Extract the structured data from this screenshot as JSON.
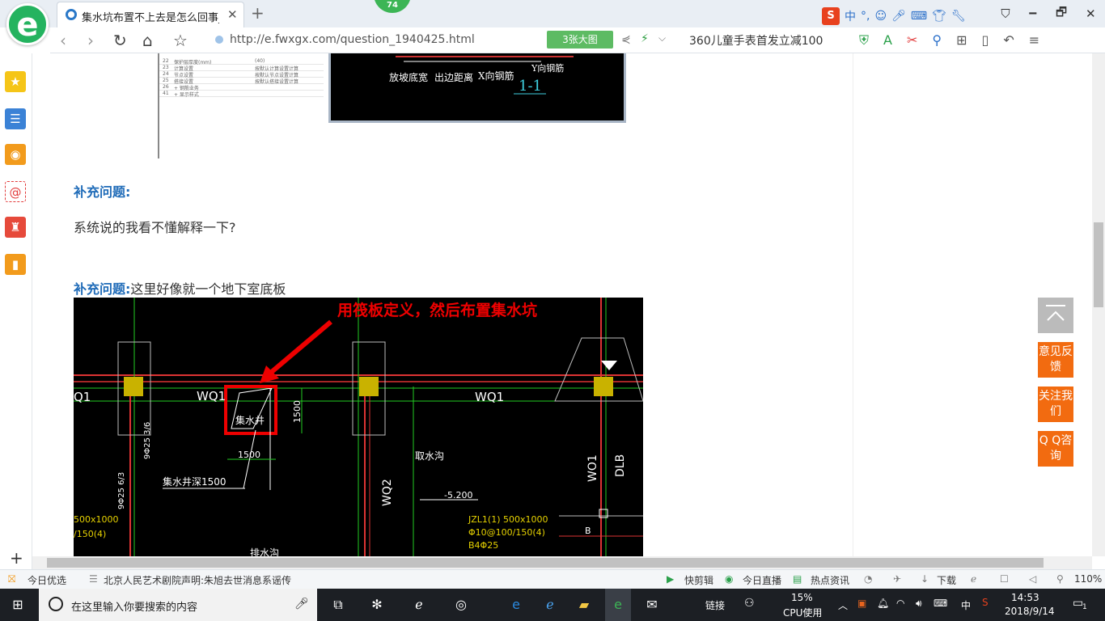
{
  "browser": {
    "tab_title": "集水坑布置不上去是怎么回事_广",
    "tab_close": "✕",
    "new_tab": "+",
    "badge": "74",
    "url": "http://e.fwxgx.com/question_1940425.html",
    "big_image_btn": "3张大图",
    "promo_text": "360儿童手表首发立减100",
    "ime_lang": "中",
    "ime_punct": "°,",
    "window_controls": [
      "🗕",
      "🗗",
      "✕"
    ]
  },
  "sidebar": {
    "items": [
      "favorites",
      "news",
      "weibo",
      "email",
      "game",
      "reader"
    ],
    "add": "+"
  },
  "page": {
    "table_rows": [
      {
        "no": "22",
        "name": "保护层厚度(mm)",
        "value": "(40)"
      },
      {
        "no": "23",
        "name": "计算设置",
        "value": "按默认计算设置计算"
      },
      {
        "no": "24",
        "name": "节点设置",
        "value": "按默认节点设置计算"
      },
      {
        "no": "25",
        "name": "搭接设置",
        "value": "按默认搭接设置计算"
      },
      {
        "no": "26",
        "name": "+ 钢筋业务",
        "value": ""
      },
      {
        "no": "41",
        "name": "+ 显示样式",
        "value": ""
      }
    ],
    "cad1_labels": {
      "y_rebar": "Y向钢筋",
      "slope": "放坡底宽",
      "edge": "出边距离",
      "x_rebar": "X向钢筋",
      "section": "1-1"
    },
    "q1_label": "补充问题:",
    "q1_text": "系统说的我看不懂解释一下?",
    "q2_label": "补充问题:",
    "q2_text": "这里好像就一个地下室底板",
    "cad2": {
      "annotation": "用筏板定义，然后布置集水坑",
      "wq1_a": "WQ1",
      "wq1_b": "WQ1",
      "q1": "Q1",
      "sump": "集水井",
      "dim_v": "1500",
      "dim_h": "1500",
      "sump_depth": "集水井深1500",
      "drain": "取水沟",
      "wq2": "WQ2",
      "wo1": "WO1",
      "dlb": "DLB",
      "elev": "-5.200",
      "beam": "JZL1(1) 500x1000",
      "stirrup": "Φ10@100/150(4)",
      "bars": "B4Φ25",
      "left_note1": "500x1000",
      "left_note2": "/150(4)",
      "rebar_v": "9Φ25 3/6",
      "rebar_v2": "9Φ25 6/3",
      "b_mark": "B",
      "drain2": "排水沟"
    }
  },
  "float_buttons": {
    "feedback": "意见反馈",
    "follow": "关注我们",
    "qq": "Q Q咨询"
  },
  "statusbar": {
    "today_pick": "今日优选",
    "headline": "北京人民艺术剧院声明:朱旭去世消息系谣传",
    "quick_cut": "快剪辑",
    "live": "今日直播",
    "hot_news": "热点资讯",
    "download": "下载",
    "zoom": "110%"
  },
  "taskbar": {
    "search_placeholder": "在这里输入你要搜索的内容",
    "links": "链接",
    "cpu_pct": "15%",
    "cpu_label": "CPU使用",
    "ime": "中",
    "time": "14:53",
    "date": "2018/9/14",
    "notify_count": "1"
  }
}
